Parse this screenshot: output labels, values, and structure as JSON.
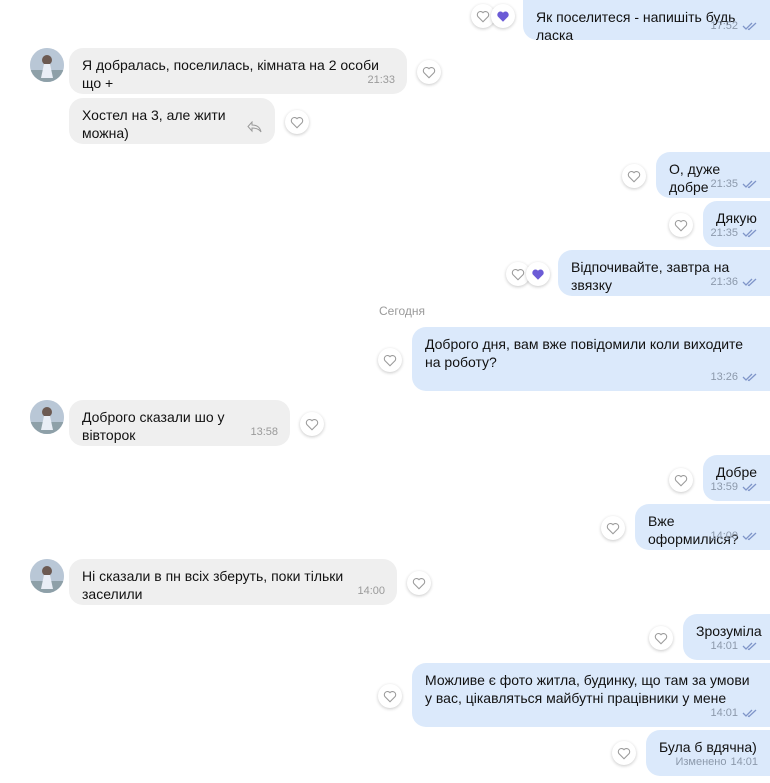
{
  "date_separator": "Сегодня",
  "messages": [
    {
      "text": "Як поселитеся - напишіть будь ласка",
      "time": "17:52"
    },
    {
      "text": "Я добралась, поселилась, кімната на 2 особи що +",
      "time": "21:33"
    },
    {
      "text": "Хостел на 3, але жити можна)"
    },
    {
      "text": "О, дуже добре",
      "time": "21:35"
    },
    {
      "text": "Дякую",
      "time": "21:35"
    },
    {
      "text": "Відпочивайте, завтра на звязку",
      "time": "21:36"
    },
    {
      "text": "Доброго дня, вам вже повідомили коли виходите на роботу?",
      "time": "13:26"
    },
    {
      "text": "Доброго сказали шо у вівторок",
      "time": "13:58"
    },
    {
      "text": "Добре",
      "time": "13:59"
    },
    {
      "text": "Вже оформилися?",
      "time": "14:00"
    },
    {
      "text": "Ні сказали в пн всіх зберуть, поки тільки заселили",
      "time": "14:00"
    },
    {
      "text": "Зрозуміла",
      "time": "14:01"
    },
    {
      "text": "Можливе є фото житла, будинку, що там за умови у вас, цікавляться майбутні працівники у мене",
      "time": "14:01"
    },
    {
      "text": "Була б вдячна)",
      "time": "14:01",
      "edited_label": "Изменено"
    }
  ],
  "colors": {
    "incoming_bubble": "#efefef",
    "outgoing_bubble": "#dbe9fb",
    "reaction_heart": "#6b5bd6",
    "read_check": "#7f95c9"
  },
  "icons": {
    "reaction": "heart-icon",
    "read_receipt": "double-check-icon",
    "reply": "reply-arrow-icon"
  }
}
